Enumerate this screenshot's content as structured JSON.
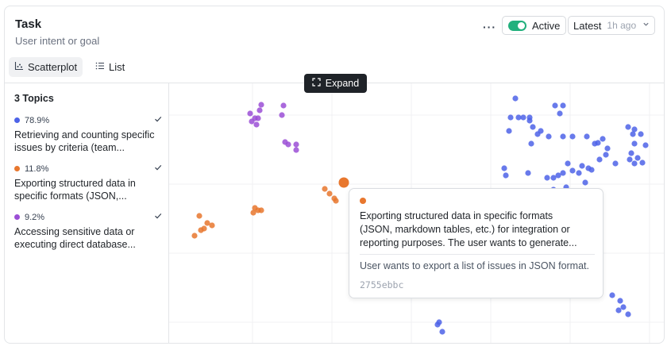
{
  "header": {
    "title": "Task",
    "subtitle": "User intent or goal",
    "more": "···",
    "active_label": "Active",
    "latest_label": "Latest",
    "latest_time": "1h ago"
  },
  "tabs": [
    {
      "label": "Scatterplot",
      "icon": "scatter-icon",
      "selected": true
    },
    {
      "label": "List",
      "icon": "list-icon",
      "selected": false
    }
  ],
  "topics": {
    "title": "3 Topics",
    "items": [
      {
        "pct": "78.9%",
        "color": "#4d63e8",
        "desc_line1": "Retrieving and counting specific",
        "desc_line2": "issues by criteria (team..."
      },
      {
        "pct": "11.8%",
        "color": "#e8772e",
        "desc_line1": "Exporting structured data in",
        "desc_line2": "specific formats (JSON,..."
      },
      {
        "pct": "9.2%",
        "color": "#9b4fd6",
        "desc_line1": "Accessing sensitive data or",
        "desc_line2": "executing direct database..."
      }
    ]
  },
  "expand_label": "Expand",
  "tooltip": {
    "color": "#e8772e",
    "line1": "Exporting structured data in specific formats",
    "line2": "(JSON, markdown tables, etc.) for integration or",
    "line3": "reporting purposes. The user wants to generate...",
    "sample": "User wants to export a list of issues in JSON format.",
    "id": "2755ebbc"
  },
  "chart_data": {
    "type": "scatter",
    "grid": true,
    "series": [
      {
        "color": "#4d63e8",
        "points": [
          [
            436,
            19
          ],
          [
            430,
            43
          ],
          [
            440,
            43
          ],
          [
            446,
            43
          ],
          [
            454,
            43
          ],
          [
            486,
            28
          ],
          [
            496,
            28
          ],
          [
            492,
            38
          ],
          [
            454,
            47
          ],
          [
            458,
            55
          ],
          [
            464,
            64
          ],
          [
            428,
            60
          ],
          [
            456,
            76
          ],
          [
            468,
            60
          ],
          [
            478,
            67
          ],
          [
            496,
            67
          ],
          [
            508,
            67
          ],
          [
            526,
            67
          ],
          [
            540,
            75
          ],
          [
            546,
            70
          ],
          [
            552,
            82
          ],
          [
            536,
            76
          ],
          [
            542,
            96
          ],
          [
            550,
            90
          ],
          [
            528,
            107
          ],
          [
            516,
            113
          ],
          [
            508,
            110
          ],
          [
            496,
            113
          ],
          [
            490,
            116
          ],
          [
            484,
            119
          ],
          [
            476,
            119
          ],
          [
            452,
            113
          ],
          [
            422,
            107
          ],
          [
            424,
            116
          ],
          [
            502,
            101
          ],
          [
            532,
            109
          ],
          [
            520,
            104
          ],
          [
            562,
            101
          ],
          [
            578,
            55
          ],
          [
            586,
            58
          ],
          [
            584,
            64
          ],
          [
            594,
            64
          ],
          [
            586,
            76
          ],
          [
            600,
            78
          ],
          [
            582,
            88
          ],
          [
            590,
            94
          ],
          [
            596,
            100
          ],
          [
            586,
            101
          ],
          [
            580,
            96
          ],
          [
            484,
            134
          ],
          [
            500,
            131
          ],
          [
            524,
            125
          ],
          [
            558,
            267
          ],
          [
            568,
            274
          ],
          [
            572,
            282
          ],
          [
            566,
            286
          ],
          [
            578,
            291
          ],
          [
            340,
            301
          ],
          [
            344,
            313
          ],
          [
            338,
            304
          ]
        ]
      },
      {
        "color": "#e8772e",
        "points": [
          [
            220,
            125
          ],
          [
            196,
            133
          ],
          [
            202,
            139
          ],
          [
            208,
            145
          ],
          [
            210,
            148
          ],
          [
            108,
            157
          ],
          [
            106,
            163
          ],
          [
            112,
            160
          ],
          [
            116,
            160
          ],
          [
            38,
            167
          ],
          [
            48,
            176
          ],
          [
            44,
            183
          ],
          [
            54,
            179
          ],
          [
            32,
            192
          ],
          [
            40,
            185
          ]
        ]
      },
      {
        "color": "#9b4fd6",
        "points": [
          [
            102,
            38
          ],
          [
            108,
            44
          ],
          [
            104,
            48
          ],
          [
            112,
            44
          ],
          [
            110,
            52
          ],
          [
            114,
            34
          ],
          [
            116,
            27
          ],
          [
            144,
            28
          ],
          [
            142,
            40
          ],
          [
            146,
            74
          ],
          [
            150,
            77
          ],
          [
            160,
            77
          ],
          [
            160,
            84
          ]
        ]
      }
    ],
    "highlight": {
      "series": 1,
      "point": [
        220,
        125
      ]
    }
  }
}
